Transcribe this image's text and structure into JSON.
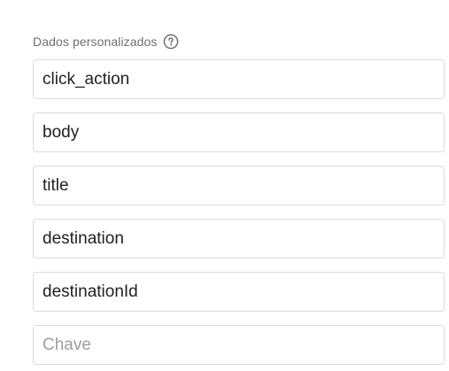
{
  "custom_data": {
    "title": "Dados personalizados",
    "help_icon": "help-circle-icon",
    "fields": [
      {
        "value": "click_action",
        "placeholder": ""
      },
      {
        "value": "body",
        "placeholder": ""
      },
      {
        "value": "title",
        "placeholder": ""
      },
      {
        "value": "destination",
        "placeholder": ""
      },
      {
        "value": "destinationId",
        "placeholder": ""
      },
      {
        "value": "",
        "placeholder": "Chave"
      }
    ]
  },
  "colors": {
    "border": "#dadce0",
    "label": "#6f6f6f",
    "text": "#212121",
    "placeholder": "#9e9e9e"
  }
}
